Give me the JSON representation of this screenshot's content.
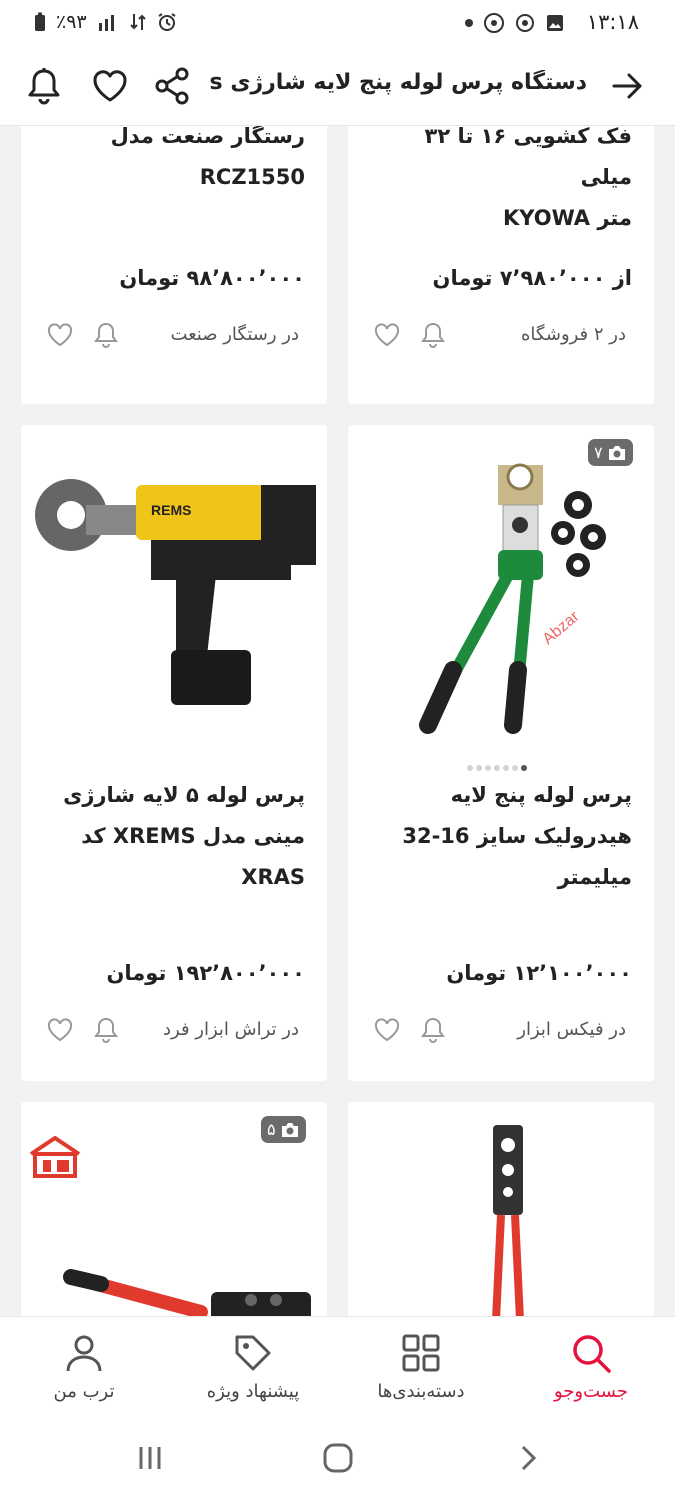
{
  "status_bar": {
    "time": "۱۳:۱۸",
    "battery": "٪۹۳"
  },
  "header": {
    "title": "دستگاه پرس لوله پنج لایه شارژی s"
  },
  "products": [
    {
      "title_lines": [
        "فک کشویی ۱۶ تا ۳۲ میلی",
        "متر KYOWA"
      ],
      "price": "از ۷٬۹۸۰٬۰۰۰ تومان",
      "seller": "در ۲ فروشگاه"
    },
    {
      "title_lines": [
        "رستگار صنعت مدل",
        "RCZ1550"
      ],
      "price": "۹۸٬۸۰۰٬۰۰۰ تومان",
      "seller": "در رستگار صنعت"
    },
    {
      "title_lines": [
        "پرس لوله پنج لایه",
        "هیدرولیک سایز 16-32",
        "میلیمتر"
      ],
      "price": "۱۲٬۱۰۰٬۰۰۰ تومان",
      "seller": "در فیکس ابزار",
      "photo_count": "۷",
      "image_watermark": "Abzar"
    },
    {
      "title_lines": [
        "پرس لوله ۵ لایه شارژی",
        "مینی مدل XREMS کد",
        "XRAS"
      ],
      "price": "۱۹۲٬۸۰۰٬۰۰۰ تومان",
      "seller": "در تراش ابزار فرد",
      "image_brand": "REMS"
    },
    {
      "photo_count": ""
    },
    {
      "photo_count": "۵"
    }
  ],
  "bottom_nav": [
    {
      "label": "جست‌وجو",
      "icon": "search-icon",
      "active": true
    },
    {
      "label": "دسته‌بندی‌ها",
      "icon": "categories-icon",
      "active": false
    },
    {
      "label": "پیشنهاد ویژه",
      "icon": "tag-icon",
      "active": false
    },
    {
      "label": "ترب من",
      "icon": "user-icon",
      "active": false
    }
  ],
  "colors": {
    "accent": "#e6123d",
    "background": "#f2f2f2"
  }
}
